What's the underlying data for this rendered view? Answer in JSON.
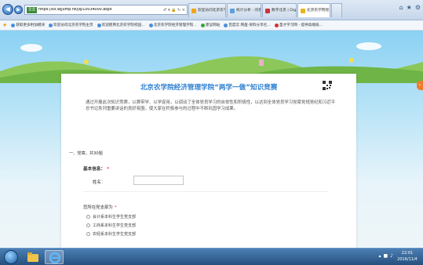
{
  "browser": {
    "url_badge": "企业",
    "url": "https://ks.wjjump.hk/jq/10034000.aspx",
    "url_tools": "♂ ▾ 🔒 ↻ ×",
    "tabs": [
      {
        "label": "欢迎访问北京农学…",
        "active": false
      },
      {
        "label": "统计分析 - 问卷…",
        "active": false
      },
      {
        "label": "数字北京 | Digital…",
        "active": false
      },
      {
        "label": "北京农学院经…",
        "active": true
      },
      {
        "label": "",
        "active": false
      }
    ],
    "window_icons": [
      "home-icon",
      "star-icon",
      "gear-icon"
    ]
  },
  "favorites": {
    "items": [
      "获取更多附加模块",
      "欢迎访问北京农学院主页",
      "欢迎使用北京农学院校园…",
      "北京农学院经济管理学院…",
      "建议网站",
      "百度云 网盘-资料分享社…",
      "圣才学习网 - 提供高端纸…"
    ]
  },
  "survey": {
    "title": "北京农学院经济管理学院“两学一做”知识竞赛",
    "intro": "通过开展此次知识竞赛，以赛带学、以学促用，以调动了全体党员学习的自觉性和积极性，以达到全体党员学习党章党规党纪和习近平总书记系列重要讲话的良好氛围，使大家在积极参与的过程中不断巩固学习成果。",
    "section_header": "一、党章，共30题",
    "basic_info_label": "基本信息：",
    "required_mark": "*",
    "name_label": "姓名：",
    "name_value": "",
    "question_label": "您所在党支部为",
    "options": [
      "会计系本科生学生党支部",
      "工商系本科生学生党支部",
      "农经系本科生学生党支部"
    ]
  },
  "taskbar": {
    "time": "22:01",
    "date": "2016/11/4"
  },
  "colors": {
    "title_blue": "#2d7fd0",
    "required_red": "#e33333",
    "sky_top": "#8bd1f3"
  }
}
